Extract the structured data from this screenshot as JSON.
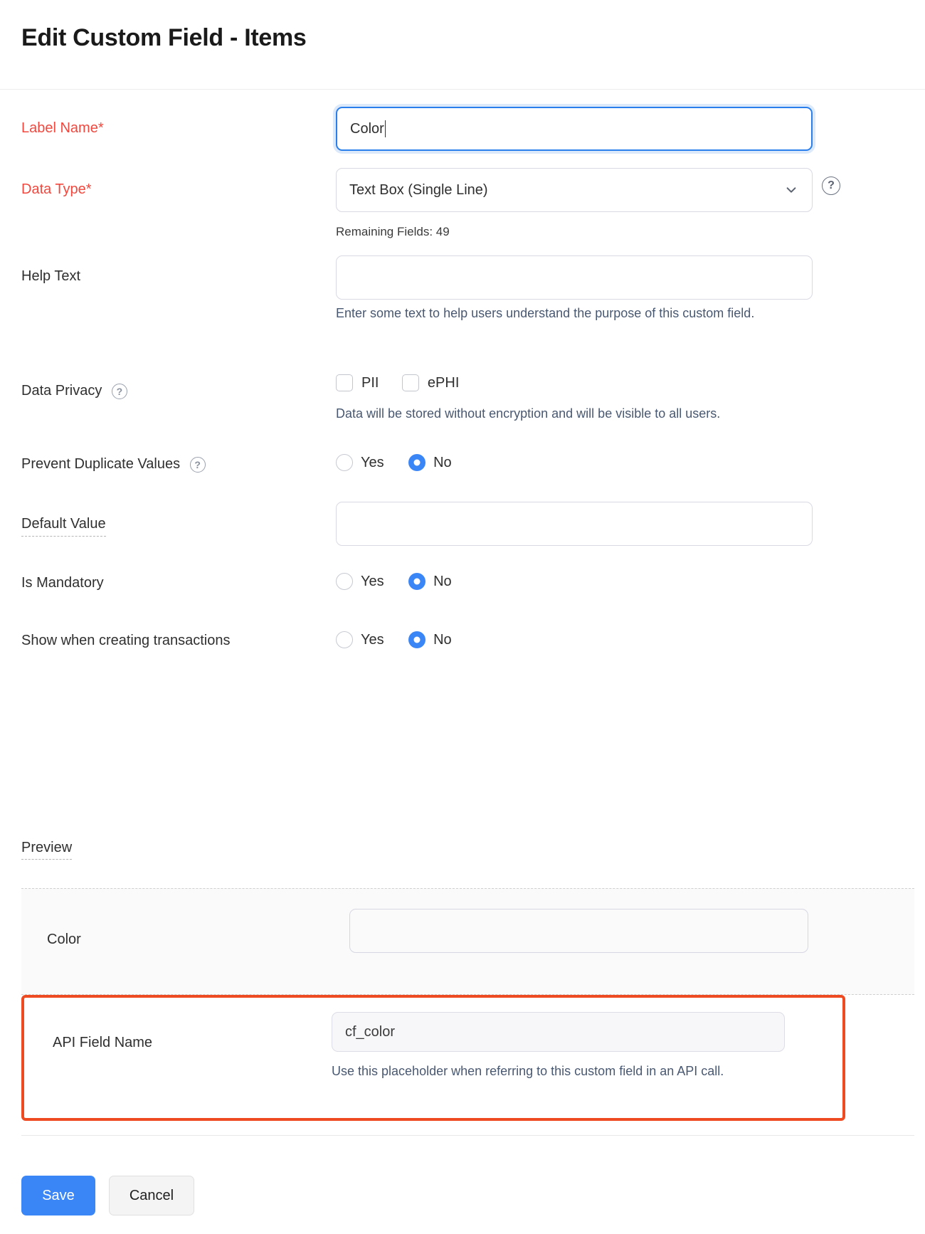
{
  "header": {
    "title": "Edit Custom Field - Items"
  },
  "form": {
    "label_name": {
      "label": "Label Name*",
      "value": "Color",
      "placeholder": ""
    },
    "data_type": {
      "label": "Data Type*",
      "value": "Text Box (Single Line)",
      "help_icon": "question-circle-icon",
      "chevron_icon": "chevron-down-icon",
      "remaining_fields": "Remaining Fields: 49"
    },
    "help_text": {
      "label": "Help Text",
      "value": "",
      "placeholder": "",
      "hint": "Enter some text to help users understand the purpose of this custom field."
    },
    "data_privacy": {
      "label": "Data Privacy",
      "help_icon": "question-circle-icon",
      "options": [
        {
          "label": "PII",
          "checked": false
        },
        {
          "label": "ePHI",
          "checked": false
        }
      ],
      "hint": "Data will be stored without encryption and will be visible to all users."
    },
    "prevent_duplicate_values": {
      "label": "Prevent Duplicate Values",
      "help_icon": "question-circle-icon",
      "options": [
        {
          "label": "Yes",
          "selected": false
        },
        {
          "label": "No",
          "selected": true
        }
      ]
    },
    "default_value": {
      "label": "Default Value",
      "value": "",
      "placeholder": ""
    },
    "is_mandatory": {
      "label": "Is Mandatory",
      "options": [
        {
          "label": "Yes",
          "selected": false
        },
        {
          "label": "No",
          "selected": true
        }
      ]
    },
    "show_when_creating": {
      "label": "Show when creating transactions",
      "options": [
        {
          "label": "Yes",
          "selected": false
        },
        {
          "label": "No",
          "selected": true
        }
      ]
    }
  },
  "preview": {
    "title": "Preview",
    "field_label": "Color",
    "field_value": "",
    "field_placeholder": ""
  },
  "api_field": {
    "label": "API Field Name",
    "value": "cf_color",
    "hint": "Use this placeholder when referring to this custom field in an API call."
  },
  "footer": {
    "save_label": "Save",
    "cancel_label": "Cancel"
  },
  "colors": {
    "required_red": "#f0483e",
    "accent_blue": "#3b86f7",
    "highlight_orange": "#ef4b23",
    "focus_border": "#2a7fec",
    "hint_text": "#495871"
  }
}
